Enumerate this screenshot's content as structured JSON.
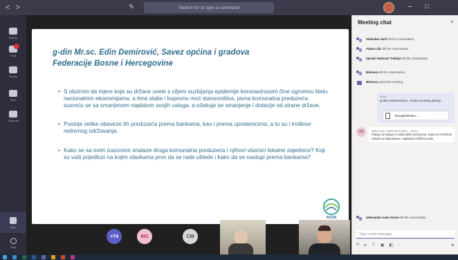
{
  "titlebar": {
    "nav_back": "<",
    "nav_forward": ">",
    "search_placeholder": "Search for or type a command",
    "minimize": "–",
    "restore": "□"
  },
  "rail": {
    "items": [
      {
        "label": "Activity",
        "icon": "bell-icon"
      },
      {
        "label": "Chat",
        "icon": "chat-icon"
      },
      {
        "label": "Teams",
        "icon": "teams-icon"
      },
      {
        "label": "Files",
        "icon": "files-icon"
      },
      {
        "label": "Calendar",
        "icon": "calendar-icon"
      }
    ],
    "apps_label": "Apps",
    "help_label": "Help"
  },
  "slide": {
    "title": "g-din Mr.sc. Edin Demirović, Savez općina i gradova Federacije Bosne i Hercegovine",
    "bullets": [
      "S obzirom da mjere koje su države uvele s ciljem suzbijanja epidemije koronavirusom čine ogromnu štetu nacionalnim ekonomijama, a time slabe i kupovnu moć stanovništva, javna komunalna preduzeća susreću se sa smanjenom naplatom svojih usluga, a očekuje se smanjenje i dotacije od strane države.",
      "Postoje velike obaveze tih preduzeća prema bankama, kao i prema uposlenicima, a tu su i troškovi redovnog održavanja.",
      "Kako se sa ovim izazovom snalaze druga komunalna preduzeća i njihovi vlasnici lokalne zajednice? Koji su vaši prijedlozi na kojim stavkama prvo da se rade uštede i kako da se nastupi prema bankama?"
    ],
    "logo_text": "RCDN"
  },
  "participants": [
    {
      "initials": "+74",
      "color": "#5b5fc7"
    },
    {
      "initials": "MG",
      "color": "#f3c1ce"
    },
    {
      "initials": "CM",
      "color": "#d6d6d6"
    }
  ],
  "chat": {
    "title": "Meeting chat",
    "close": "×",
    "events": [
      {
        "name": "Slobodan Jurić",
        "text": "left the conversation."
      },
      {
        "name": "Adnan Lilic",
        "text": "left the conversation."
      },
      {
        "name": "Sjenski Radovan Trebinje",
        "text": "left the conversation."
      },
      {
        "name": "Mimoura",
        "text": "left the conversation."
      },
      {
        "name": "Mimoura",
        "text": "joined the meeting."
      }
    ],
    "bubble": {
      "sender": "Vlado",
      "text": "g-dine Sakuramaca , hvala na Vasoj pitanju",
      "file_name": "TIrnajDOPUNA..."
    },
    "message": {
      "avatar": "VS",
      "header": "Šaka Vela. Vodovod Kozarc... 15:04",
      "text": "Pitanje za kolege iz vodovodnih preduzeća: Kako se COVID19 odrazio na fakturisane i naplaćene količine vode"
    },
    "last_event": {
      "name": "aleksandar sveto teruse",
      "text": "left the conversation."
    },
    "compose_placeholder": "Type a new message"
  },
  "colors": {
    "accent": "#6264a7",
    "slide_text": "#2f6d8c",
    "titlebar": "#3a3a4a"
  }
}
